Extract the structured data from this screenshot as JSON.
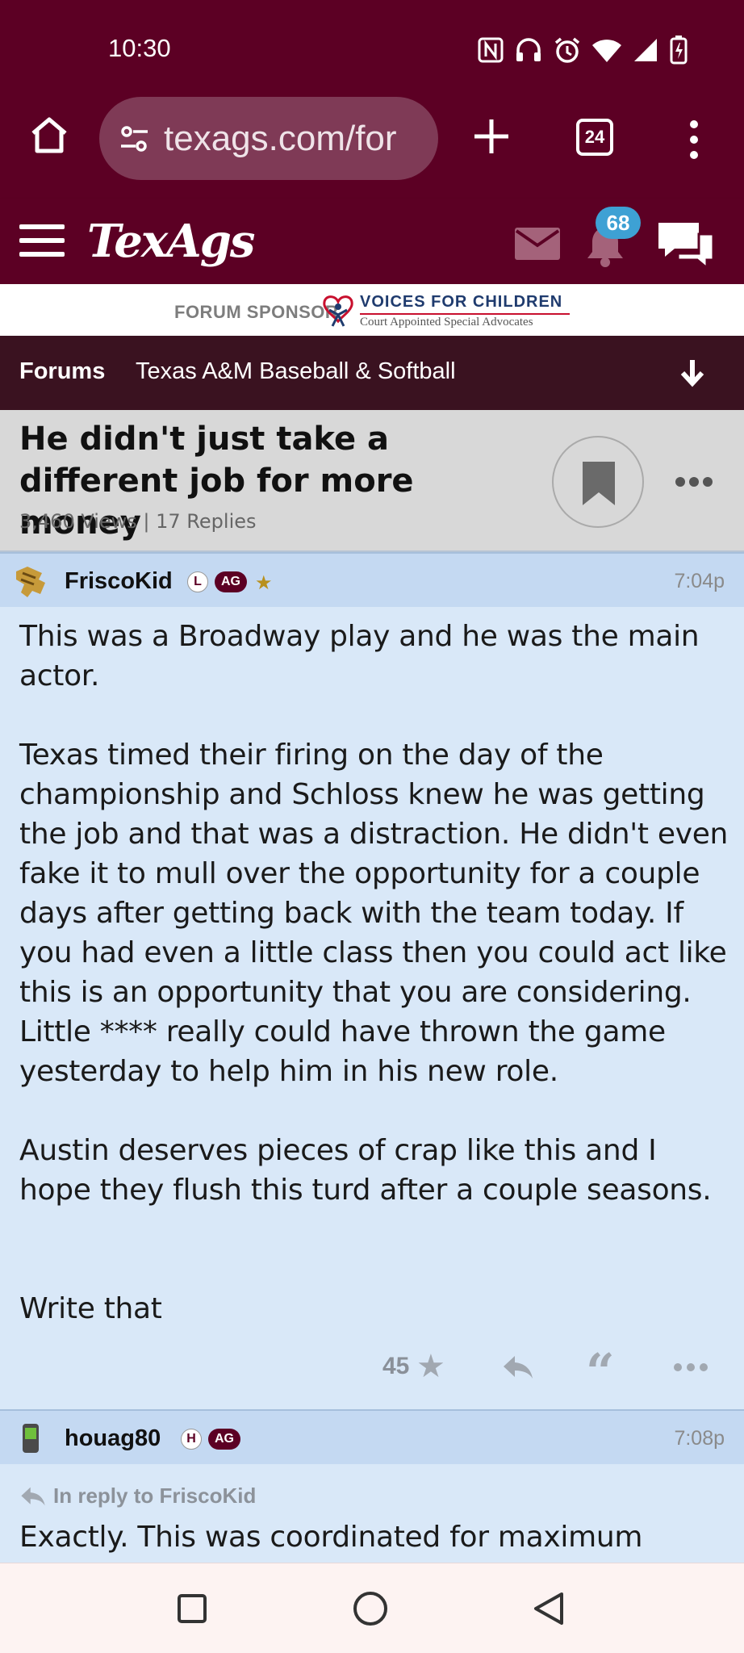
{
  "status": {
    "time": "10:30",
    "icons": [
      "nfc-icon",
      "headphones-icon",
      "alarm-icon",
      "wifi-icon",
      "signal-icon",
      "battery-charging-icon"
    ]
  },
  "browser": {
    "url": "texags.com/for",
    "tab_count": "24"
  },
  "site": {
    "logo": "TexAgs",
    "notification_count": "68",
    "brand_color": "#5c0024"
  },
  "sponsor": {
    "label": "FORUM SPONSOR",
    "org_name": "VOICES FOR CHILDREN",
    "org_sub": "Court Appointed Special Advocates"
  },
  "nav": {
    "forums": "Forums",
    "board": "Texas A&M Baseball & Softball"
  },
  "thread": {
    "title": "He didn't just take a different job for more money",
    "meta": "3,460 Views | 17 Replies"
  },
  "posts": [
    {
      "username": "FriscoKid",
      "badge1": "L",
      "badge2": "AG",
      "star": "★",
      "time": "7:04p",
      "paragraphs": [
        "This was a Broadway play and he was the main actor.",
        "Texas timed their firing on the day of the championship and Schloss knew he was getting the job and that was a distraction. He didn't even fake it to mull over the opportunity for a couple days after getting back with the team today. If you had even a little class then you could act like this is an opportunity that you are considering. Little **** really could have thrown the game yesterday to help him in his new role.",
        "Austin deserves pieces of crap like this and I hope they flush this turd after a couple seasons.",
        "Write that"
      ],
      "star_count": "45"
    },
    {
      "username": "houag80",
      "badge1": "H",
      "badge2": "AG",
      "time": "7:08p",
      "in_reply_to": "In reply to FriscoKid",
      "first_line": "Exactly. This was coordinated for maximum"
    }
  ]
}
